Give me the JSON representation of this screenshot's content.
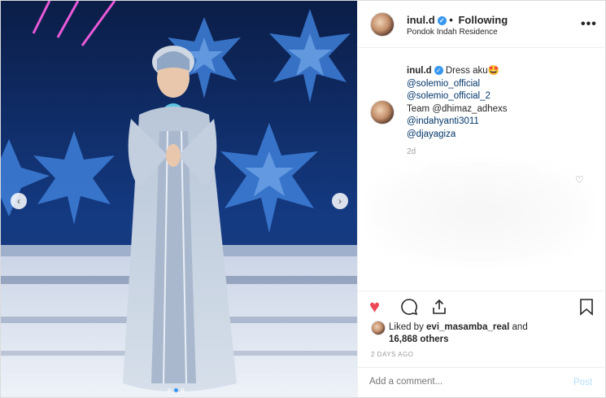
{
  "header": {
    "username": "inul.d",
    "separator": "•",
    "follow_status": "Following",
    "location": "Pondok Indah Residence",
    "more_label": "•••"
  },
  "caption": {
    "username": "inul.d",
    "text": "Dress aku🤩",
    "mentions": [
      "@solemio_official",
      "@solemio_official_2"
    ],
    "team_line": "Team @dhimaz_adhexs",
    "mentions2": [
      "@indahyanti3011",
      "@djayagiza"
    ],
    "time": "2d"
  },
  "actions": {
    "like_icon": "heart-filled-icon",
    "comment_icon": "comment-icon",
    "share_icon": "share-icon",
    "save_icon": "bookmark-icon"
  },
  "likes": {
    "prefix": "Liked by ",
    "user": "evi_masamba_real",
    "and": " and",
    "count": "16,868 others"
  },
  "posted_ago": "2 DAYS AGO",
  "comment": {
    "placeholder": "Add a comment...",
    "post_label": "Post"
  },
  "media": {
    "prev_label": "‹",
    "next_label": "›",
    "slides_total": 3,
    "active_slide": 2
  },
  "colors": {
    "like": "#ed4956",
    "link": "#003569",
    "verified": "#3897f0",
    "post_disabled": "#b2dffc"
  }
}
